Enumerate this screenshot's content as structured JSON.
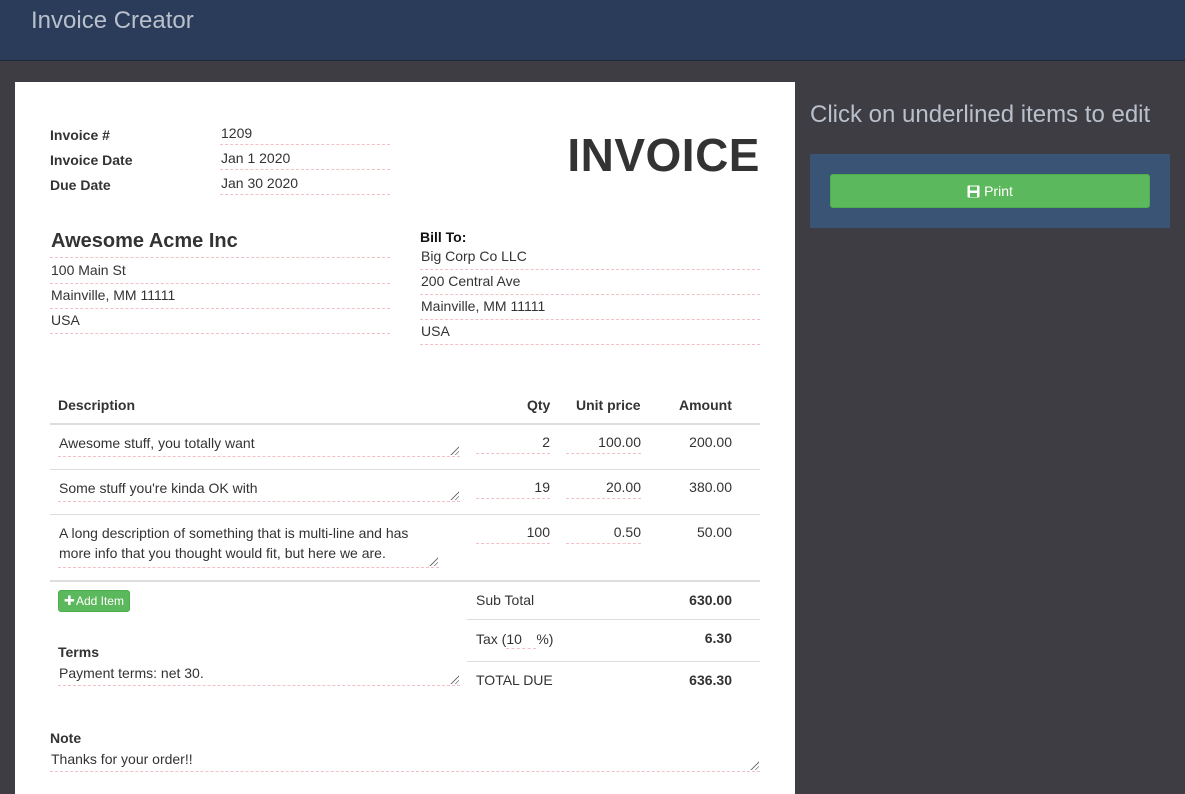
{
  "app": {
    "title": "Invoice Creator"
  },
  "sidebar": {
    "hint": "Click on underlined items to edit",
    "print_label": "Print"
  },
  "invoice": {
    "heading": "INVOICE",
    "meta": [
      {
        "label": "Invoice #",
        "value": "1209"
      },
      {
        "label": "Invoice Date",
        "value": "Jan 1 2020"
      },
      {
        "label": "Due Date",
        "value": "Jan 30 2020"
      }
    ],
    "from": {
      "name": "Awesome Acme Inc",
      "lines": [
        "100 Main St",
        "Mainville, MM 11111",
        "USA"
      ]
    },
    "bill_to": {
      "heading": "Bill To:",
      "lines": [
        "Big Corp Co LLC",
        "200 Central Ave",
        "Mainville, MM 11111",
        "USA"
      ]
    },
    "table": {
      "headers": {
        "description": "Description",
        "qty": "Qty",
        "unit_price": "Unit price",
        "amount": "Amount"
      },
      "rows": [
        {
          "description": "Awesome stuff, you totally want",
          "qty": "2",
          "unit_price": "100.00",
          "amount": "200.00"
        },
        {
          "description": "Some stuff you're kinda OK with",
          "qty": "19",
          "unit_price": "20.00",
          "amount": "380.00"
        },
        {
          "description": "A long description of something that is multi-line and has more info that you thought would fit, but here we are.",
          "qty": "100",
          "unit_price": "0.50",
          "amount": "50.00"
        }
      ]
    },
    "add_item_label": "Add Item",
    "totals": {
      "subtotal_label": "Sub Total",
      "subtotal": "630.00",
      "tax_label_prefix": "Tax (",
      "tax_rate": "10",
      "tax_label_suffix": "%)",
      "tax": "6.30",
      "total_label": "TOTAL DUE",
      "total": "636.30"
    },
    "terms": {
      "label": "Terms",
      "value": "Payment terms: net 30."
    },
    "note": {
      "label": "Note",
      "value": "Thanks for your order!!"
    }
  },
  "colors": {
    "topbar": "#2a3c5a",
    "background": "#3e3d43",
    "panel": "#3a5475",
    "button": "#5cb85c",
    "edit_underline": "#f3c0c6"
  }
}
